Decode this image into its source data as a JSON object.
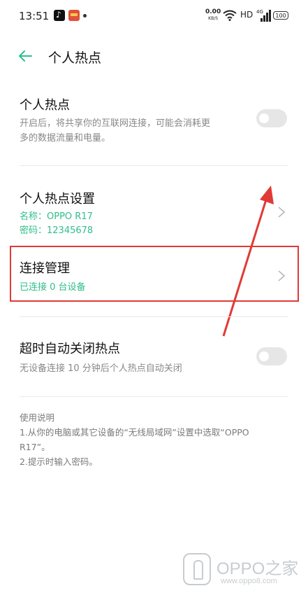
{
  "status_bar": {
    "time": "13:51",
    "net_speed_value": "0.00",
    "net_speed_unit": "KB/S",
    "hd": "HD",
    "network": "4G",
    "battery": "100",
    "notification_icons": [
      "tiktok-icon",
      "news-app-icon"
    ]
  },
  "header": {
    "title": "个人热点"
  },
  "hotspot": {
    "title": "个人热点",
    "desc_line1": "开启后，将共享你的互联网连接，可能会消耗更",
    "desc_line2": "多的数据流量和电量。",
    "enabled": false
  },
  "settings": {
    "title": "个人热点设置",
    "name_line": "名称：OPPO R17",
    "password_line": "密码：12345678"
  },
  "connection": {
    "title": "连接管理",
    "status": "已连接 0 台设备"
  },
  "auto_off": {
    "title": "超时自动关闭热点",
    "desc": "无设备连接 10 分钟后个人热点自动关闭",
    "enabled": false
  },
  "usage": {
    "heading": "使用说明",
    "line1": "1.从你的电脑或其它设备的“无线局域网”设置中选取“OPPO",
    "line2": "R17”。",
    "line3": "2.提示时输入密码。"
  },
  "watermark": {
    "brand": "OPPO之家",
    "url": "www.oppo8.com"
  },
  "colors": {
    "accent": "#2fbf8a",
    "annotation": "#e03a36"
  }
}
